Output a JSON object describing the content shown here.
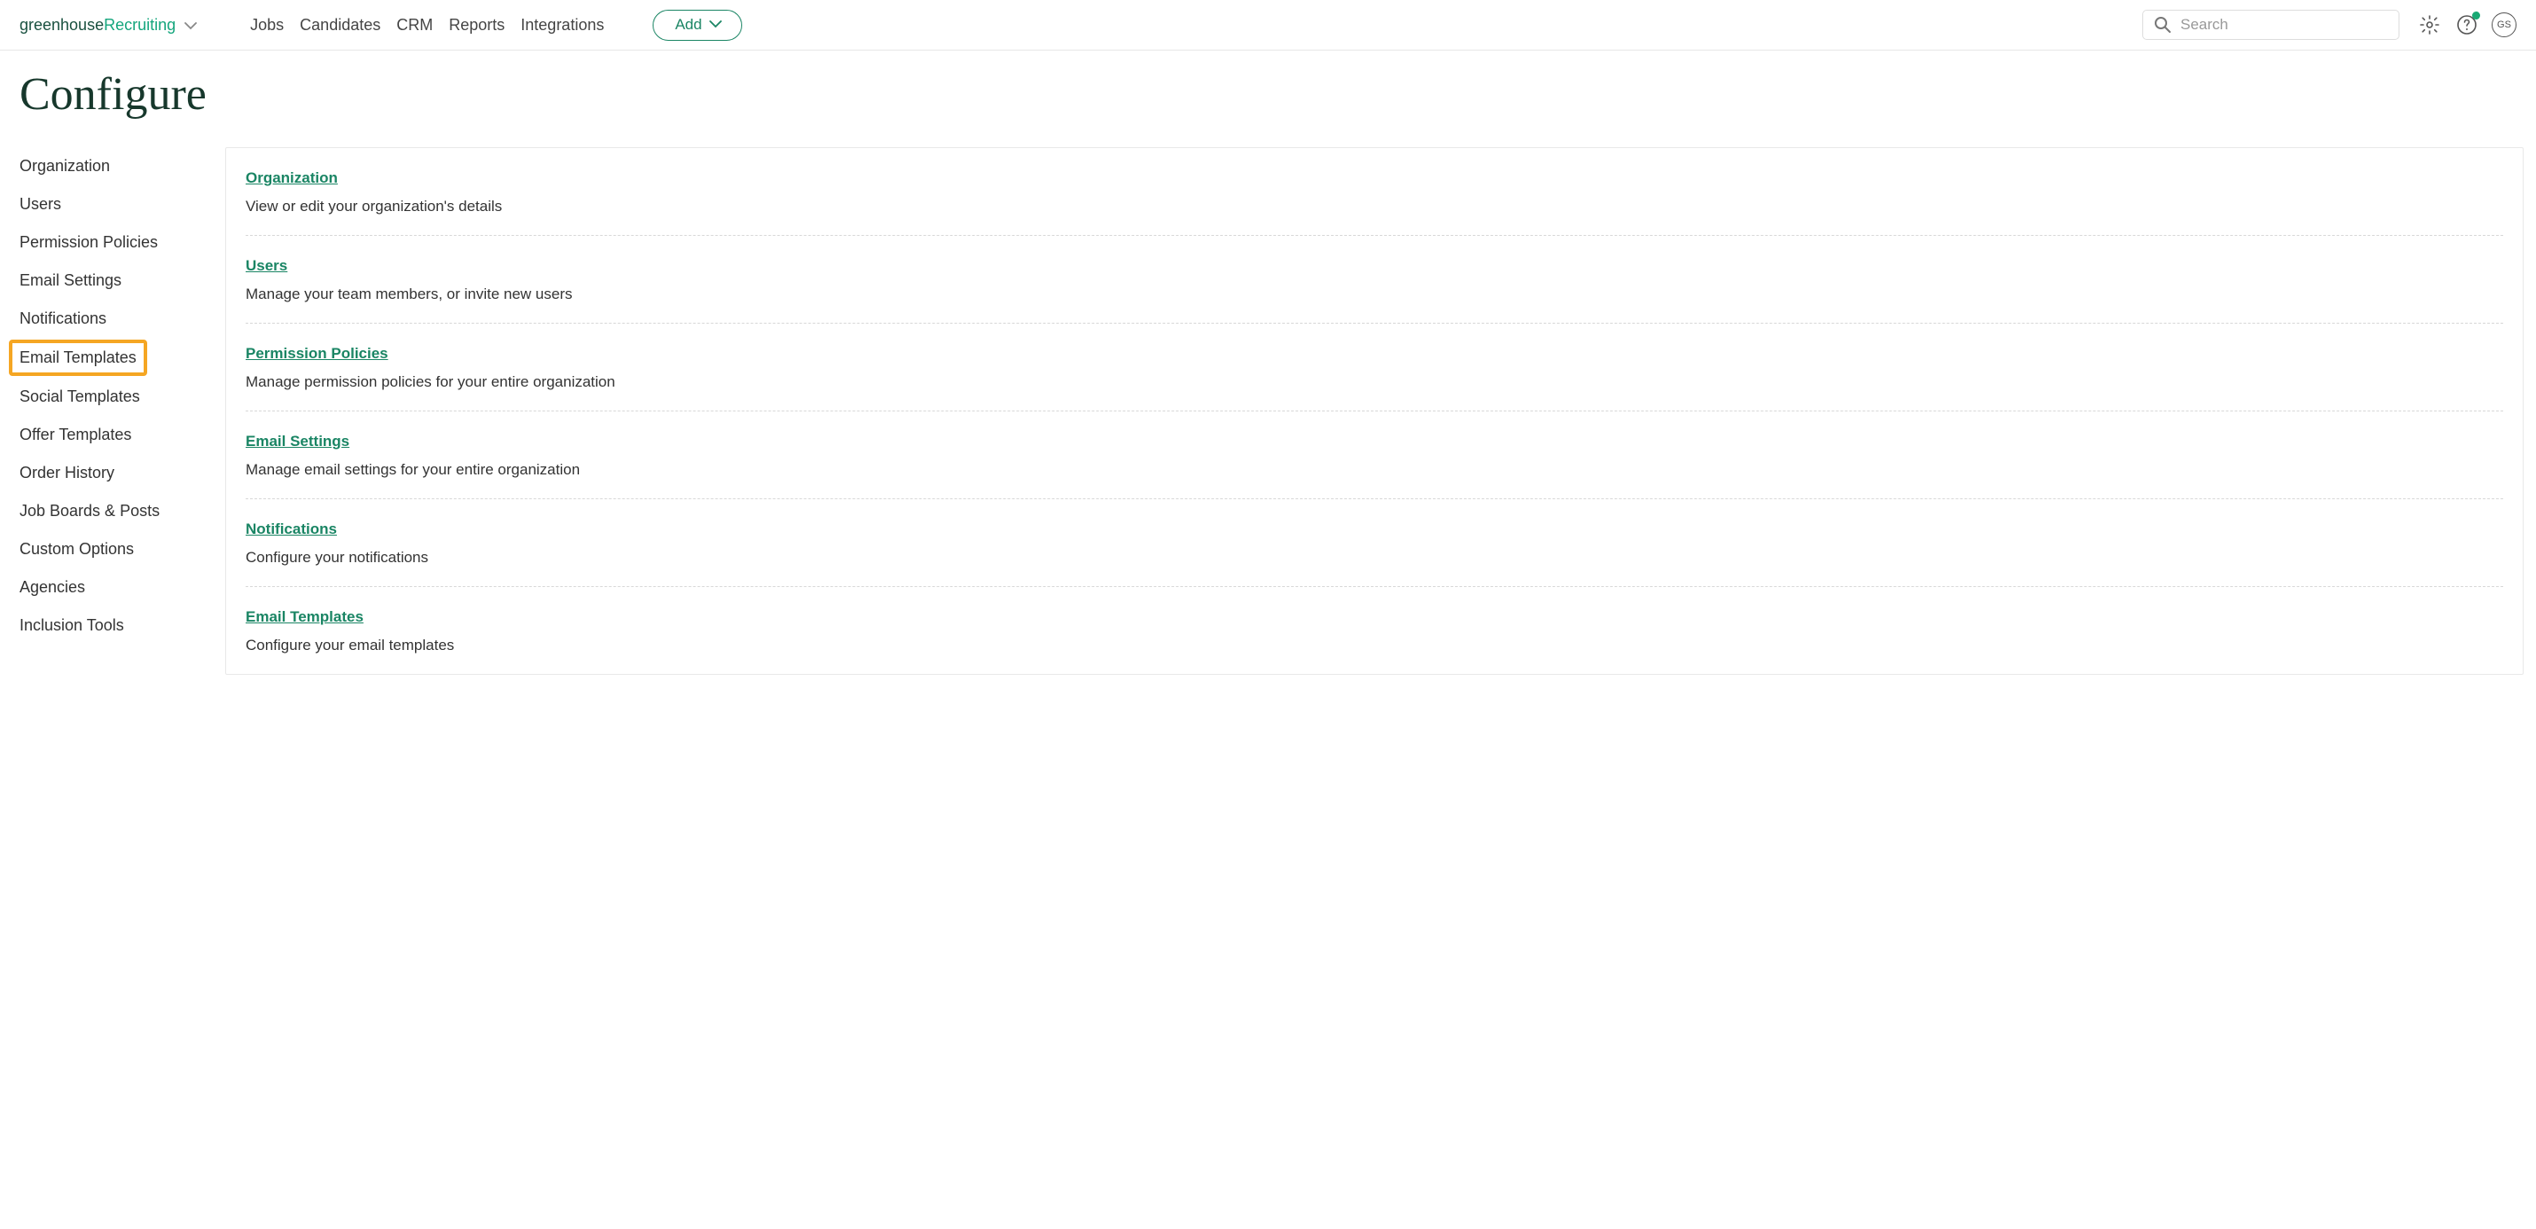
{
  "logo": {
    "part1": "greenhouse",
    "part2": " Recruiting"
  },
  "nav": {
    "jobs": "Jobs",
    "candidates": "Candidates",
    "crm": "CRM",
    "reports": "Reports",
    "integrations": "Integrations"
  },
  "add_button": "Add",
  "search": {
    "placeholder": "Search"
  },
  "avatar_initials": "GS",
  "page_title": "Configure",
  "sidebar": {
    "items": [
      {
        "label": "Organization",
        "highlighted": false
      },
      {
        "label": "Users",
        "highlighted": false
      },
      {
        "label": "Permission Policies",
        "highlighted": false
      },
      {
        "label": "Email Settings",
        "highlighted": false
      },
      {
        "label": "Notifications",
        "highlighted": false
      },
      {
        "label": "Email Templates",
        "highlighted": true
      },
      {
        "label": "Social Templates",
        "highlighted": false
      },
      {
        "label": "Offer Templates",
        "highlighted": false
      },
      {
        "label": "Order History",
        "highlighted": false
      },
      {
        "label": "Job Boards & Posts",
        "highlighted": false
      },
      {
        "label": "Custom Options",
        "highlighted": false
      },
      {
        "label": "Agencies",
        "highlighted": false
      },
      {
        "label": "Inclusion Tools",
        "highlighted": false
      }
    ]
  },
  "sections": [
    {
      "title": "Organization",
      "desc": "View or edit your organization's details"
    },
    {
      "title": "Users",
      "desc": "Manage your team members, or invite new users"
    },
    {
      "title": "Permission Policies",
      "desc": "Manage permission policies for your entire organization"
    },
    {
      "title": "Email Settings",
      "desc": "Manage email settings for your entire organization"
    },
    {
      "title": "Notifications",
      "desc": "Configure your notifications"
    },
    {
      "title": "Email Templates",
      "desc": "Configure your email templates"
    }
  ],
  "colors": {
    "brand_green": "#1a8564",
    "dark_green": "#17382c",
    "highlight_orange": "#f5a623"
  }
}
